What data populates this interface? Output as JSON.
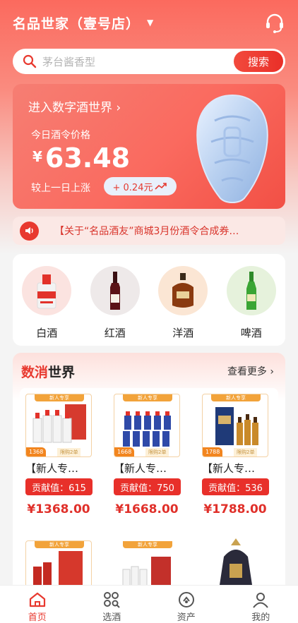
{
  "header": {
    "store_title": "名品世家（壹号店）"
  },
  "search": {
    "placeholder": "茅台酱香型",
    "button_label": "搜索"
  },
  "banner": {
    "enter_label": "进入数字酒世界 ›",
    "price_label": "今日酒令价格",
    "currency_symbol": "¥",
    "price": "63.48",
    "compare_label": "较上一日上涨",
    "change": "+ 0.24元"
  },
  "notice": {
    "text": "【关于“名品酒友”商城3月份酒令合成券…"
  },
  "categories": [
    {
      "label": "白酒"
    },
    {
      "label": "红酒"
    },
    {
      "label": "洋酒"
    },
    {
      "label": "啤酒"
    }
  ],
  "shop": {
    "title_accent": "数消",
    "title_rest": "世界",
    "more_label": "查看更多 ›",
    "products": [
      {
        "name": "【新人专…",
        "contribution": "贡献值：615",
        "price": "¥1368.00",
        "tag_price": "1368",
        "new_tag": "新人专享",
        "limit": "限购2单"
      },
      {
        "name": "【新人专…",
        "contribution": "贡献值：750",
        "price": "¥1668.00",
        "tag_price": "1668",
        "new_tag": "新人专享",
        "limit": "限购2单"
      },
      {
        "name": "【新人专…",
        "contribution": "贡献值：536",
        "price": "¥1788.00",
        "tag_price": "1788",
        "new_tag": "新人专享",
        "limit": "限购2单"
      }
    ],
    "second_row_tags": [
      "新人专享",
      "新人专享"
    ]
  },
  "tabbar": [
    {
      "label": "首页",
      "icon": "home-icon",
      "active": true
    },
    {
      "label": "选酒",
      "icon": "grid-search-icon",
      "active": false
    },
    {
      "label": "资产",
      "icon": "asset-icon",
      "active": false
    },
    {
      "label": "我的",
      "icon": "user-icon",
      "active": false
    }
  ],
  "colors": {
    "accent": "#e8392f",
    "banner": "#fa6a5f",
    "price_tag": "#f2851e"
  }
}
